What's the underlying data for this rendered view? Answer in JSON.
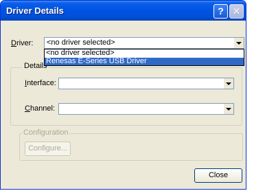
{
  "window": {
    "title": "Driver Details"
  },
  "titlebar": {
    "help_label": "?",
    "close_label": "✕"
  },
  "driver": {
    "label_accel": "D",
    "label_rest": "river:",
    "selected": "<no driver selected>",
    "options": [
      "<no driver selected>",
      "Renesas E-Series USB Driver"
    ],
    "highlighted_index": 1
  },
  "details": {
    "title": "Details",
    "interface": {
      "label_accel": "I",
      "label_rest": "nterface:",
      "value": ""
    },
    "channel": {
      "label_accel": "C",
      "label_rest": "hannel:",
      "value": ""
    }
  },
  "configuration": {
    "title": "Configuration",
    "configure_label": "Configure..."
  },
  "footer": {
    "close_label": "Close"
  }
}
